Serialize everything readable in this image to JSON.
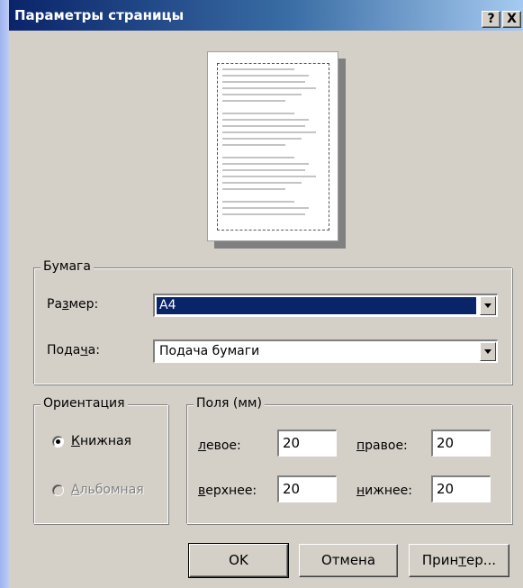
{
  "window": {
    "title": "Параметры страницы",
    "help_label": "?",
    "close_label": "X"
  },
  "paper": {
    "group_label": "Бумага",
    "size_label_pre": "Ра",
    "size_label_hot": "з",
    "size_label_post": "мер:",
    "size_value": "A4",
    "source_label_pre": "Пода",
    "source_label_hot": "ч",
    "source_label_post": "а:",
    "source_value": "Подача бумаги"
  },
  "orientation": {
    "group_label": "Ориентация",
    "portrait_hot": "К",
    "portrait_post": "нижная",
    "portrait_selected": true,
    "landscape_hot": "А",
    "landscape_post": "льбомная",
    "landscape_enabled": false
  },
  "margins": {
    "group_label": "Поля (мм)",
    "left_hot": "л",
    "left_post": "евое:",
    "left_value": "20",
    "right_hot": "п",
    "right_post": "равое:",
    "right_value": "20",
    "top_hot": "в",
    "top_post": "ерхнее:",
    "top_value": "20",
    "bottom_hot": "н",
    "bottom_post": "ижнее:",
    "bottom_value": "20"
  },
  "buttons": {
    "ok": "OK",
    "cancel": "Отмена",
    "printer_pre": "Прин",
    "printer_hot": "т",
    "printer_post": "ер..."
  }
}
